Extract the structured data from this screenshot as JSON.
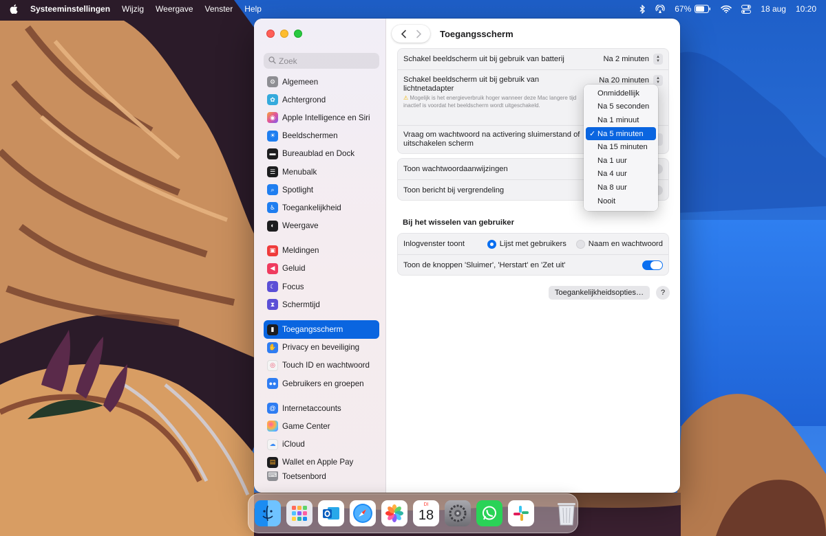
{
  "menubar": {
    "app_name": "Systeeminstellingen",
    "menus": [
      "Wijzig",
      "Weergave",
      "Venster",
      "Help"
    ],
    "battery": "67%",
    "date": "18 aug",
    "time": "10:20"
  },
  "window": {
    "title": "Toegangsscherm",
    "search_placeholder": "Zoek"
  },
  "sidebar": {
    "groups": [
      [
        {
          "label": "Algemeen",
          "icon": "gear-icon",
          "color": "#8e8e93"
        },
        {
          "label": "Achtergrond",
          "icon": "wallpaper-icon",
          "color": "#35aadc"
        },
        {
          "label": "Apple Intelligence en Siri",
          "icon": "siri-icon",
          "color": "#e0559a"
        },
        {
          "label": "Beeldschermen",
          "icon": "sun-icon",
          "color": "#1f7ef0"
        },
        {
          "label": "Bureaublad en Dock",
          "icon": "dock-icon",
          "color": "#1d1d1f"
        },
        {
          "label": "Menubalk",
          "icon": "menubar-icon",
          "color": "#1d1d1f"
        },
        {
          "label": "Spotlight",
          "icon": "search-icon",
          "color": "#1f7ef0"
        },
        {
          "label": "Toegankelijkheid",
          "icon": "accessibility-icon",
          "color": "#1f7ef0"
        },
        {
          "label": "Weergave",
          "icon": "appearance-icon",
          "color": "#1d1d1f"
        }
      ],
      [
        {
          "label": "Meldingen",
          "icon": "bell-icon",
          "color": "#ef3b3b"
        },
        {
          "label": "Geluid",
          "icon": "speaker-icon",
          "color": "#ef3b5e"
        },
        {
          "label": "Focus",
          "icon": "moon-icon",
          "color": "#5b4fd6"
        },
        {
          "label": "Schermtijd",
          "icon": "hourglass-icon",
          "color": "#5b4fd6"
        }
      ],
      [
        {
          "label": "Toegangsscherm",
          "icon": "lock-screen-icon",
          "color": "#1d1d1f",
          "active": true
        },
        {
          "label": "Privacy en beveiliging",
          "icon": "hand-icon",
          "color": "#2f7df2"
        },
        {
          "label": "Touch ID en wachtwoord",
          "icon": "fingerprint-icon",
          "color": "#f2f2f2"
        },
        {
          "label": "Gebruikers en groepen",
          "icon": "users-icon",
          "color": "#2f7df2"
        }
      ],
      [
        {
          "label": "Internetaccounts",
          "icon": "at-icon",
          "color": "#2f7df2"
        },
        {
          "label": "Game Center",
          "icon": "game-center-icon",
          "color": "#f2f2f2"
        },
        {
          "label": "iCloud",
          "icon": "cloud-icon",
          "color": "#f2f2f2"
        },
        {
          "label": "Wallet en Apple Pay",
          "icon": "wallet-icon",
          "color": "#1d1d1f"
        },
        {
          "label": "Toetsenbord",
          "icon": "keyboard-icon",
          "color": "#8e8e93"
        }
      ]
    ]
  },
  "settings": {
    "battery_label": "Schakel beeldscherm uit bij gebruik van batterij",
    "battery_value": "Na 2 minuten",
    "adapter_label": "Schakel beeldscherm uit bij gebruik van lichtnetadapter",
    "adapter_value": "Na 20 minuten",
    "adapter_warning": "Mogelijk is het energieverbruik hoger wanneer deze Mac langere tijd inactief is voordat het beeldscherm wordt uitgeschakeld.",
    "password_label": "Vraag om wachtwoord na activering sluimerstand of uitschakelen scherm",
    "hints_label": "Toon wachtwoordaanwijzingen",
    "message_label": "Toon bericht bij vergrendeling",
    "switch_section": "Bij het wisselen van gebruiker",
    "login_label": "Inlogvenster toont",
    "login_option_1": "Lijst met gebruikers",
    "login_option_2": "Naam en wachtwoord",
    "buttons_label": "Toon de knoppen 'Sluimer', 'Herstart' en 'Zet uit'",
    "accessibility_button": "Toegankelijkheidsopties…",
    "help_button": "?"
  },
  "dropdown": {
    "options": [
      "Onmiddellijk",
      "Na 5 seconden",
      "Na 1 minuut",
      "Na 5 minuten",
      "Na 15 minuten",
      "Na 1 uur",
      "Na 4 uur",
      "Na 8 uur",
      "Nooit"
    ],
    "selected_index": 3
  },
  "dock": {
    "apps": [
      "finder-icon",
      "launchpad-icon",
      "outlook-icon",
      "safari-icon",
      "photos-icon",
      "calendar-icon",
      "system-settings-icon",
      "whatsapp-icon",
      "slack-icon"
    ],
    "calendar_day": "18",
    "calendar_month": "DI",
    "trash": "trash-icon"
  }
}
